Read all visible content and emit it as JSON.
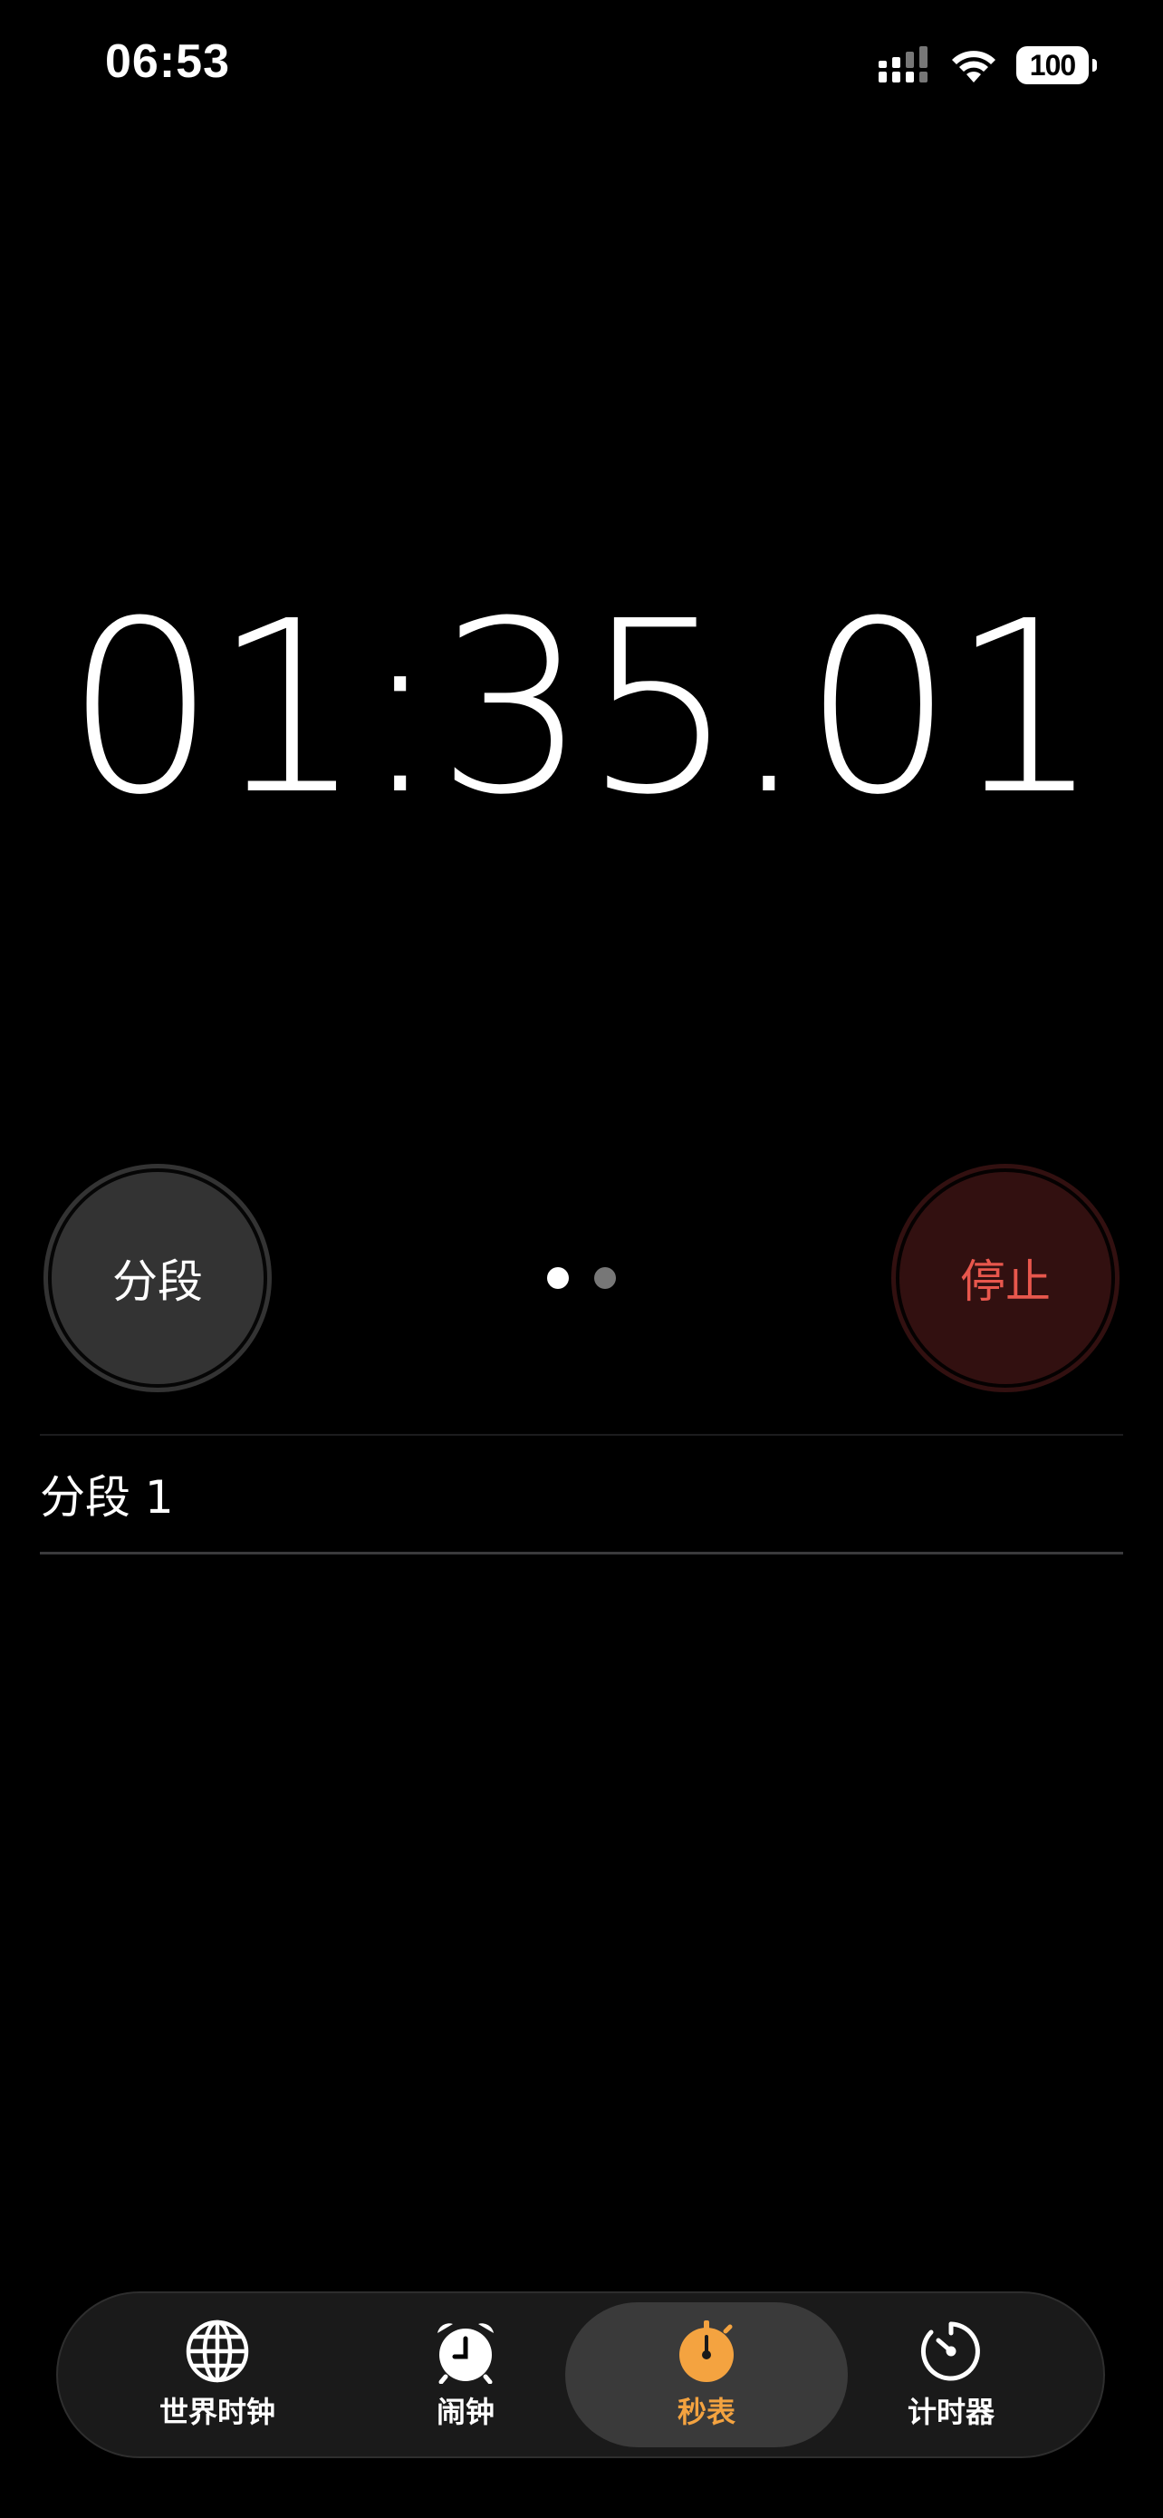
{
  "status_bar": {
    "time": "06:53",
    "battery_level": "100"
  },
  "stopwatch": {
    "elapsed": "01:35.01"
  },
  "buttons": {
    "lap_label": "分段",
    "stop_label": "停止"
  },
  "pager": {
    "page_count": 2,
    "active_page": 1
  },
  "laps": [
    {
      "label": "分段 1",
      "time": ""
    }
  ],
  "tab_bar": {
    "selected": "秒表",
    "tabs": [
      {
        "label": "世界时钟",
        "icon": "globe-icon"
      },
      {
        "label": "闹钟",
        "icon": "alarm-clock-icon"
      },
      {
        "label": "秒表",
        "icon": "stopwatch-icon"
      },
      {
        "label": "计时器",
        "icon": "timer-icon"
      }
    ]
  },
  "colors": {
    "accent": "#f4a340",
    "stop_text": "#e8574d",
    "stop_bg": "#321010",
    "lap_bg": "#333333"
  }
}
